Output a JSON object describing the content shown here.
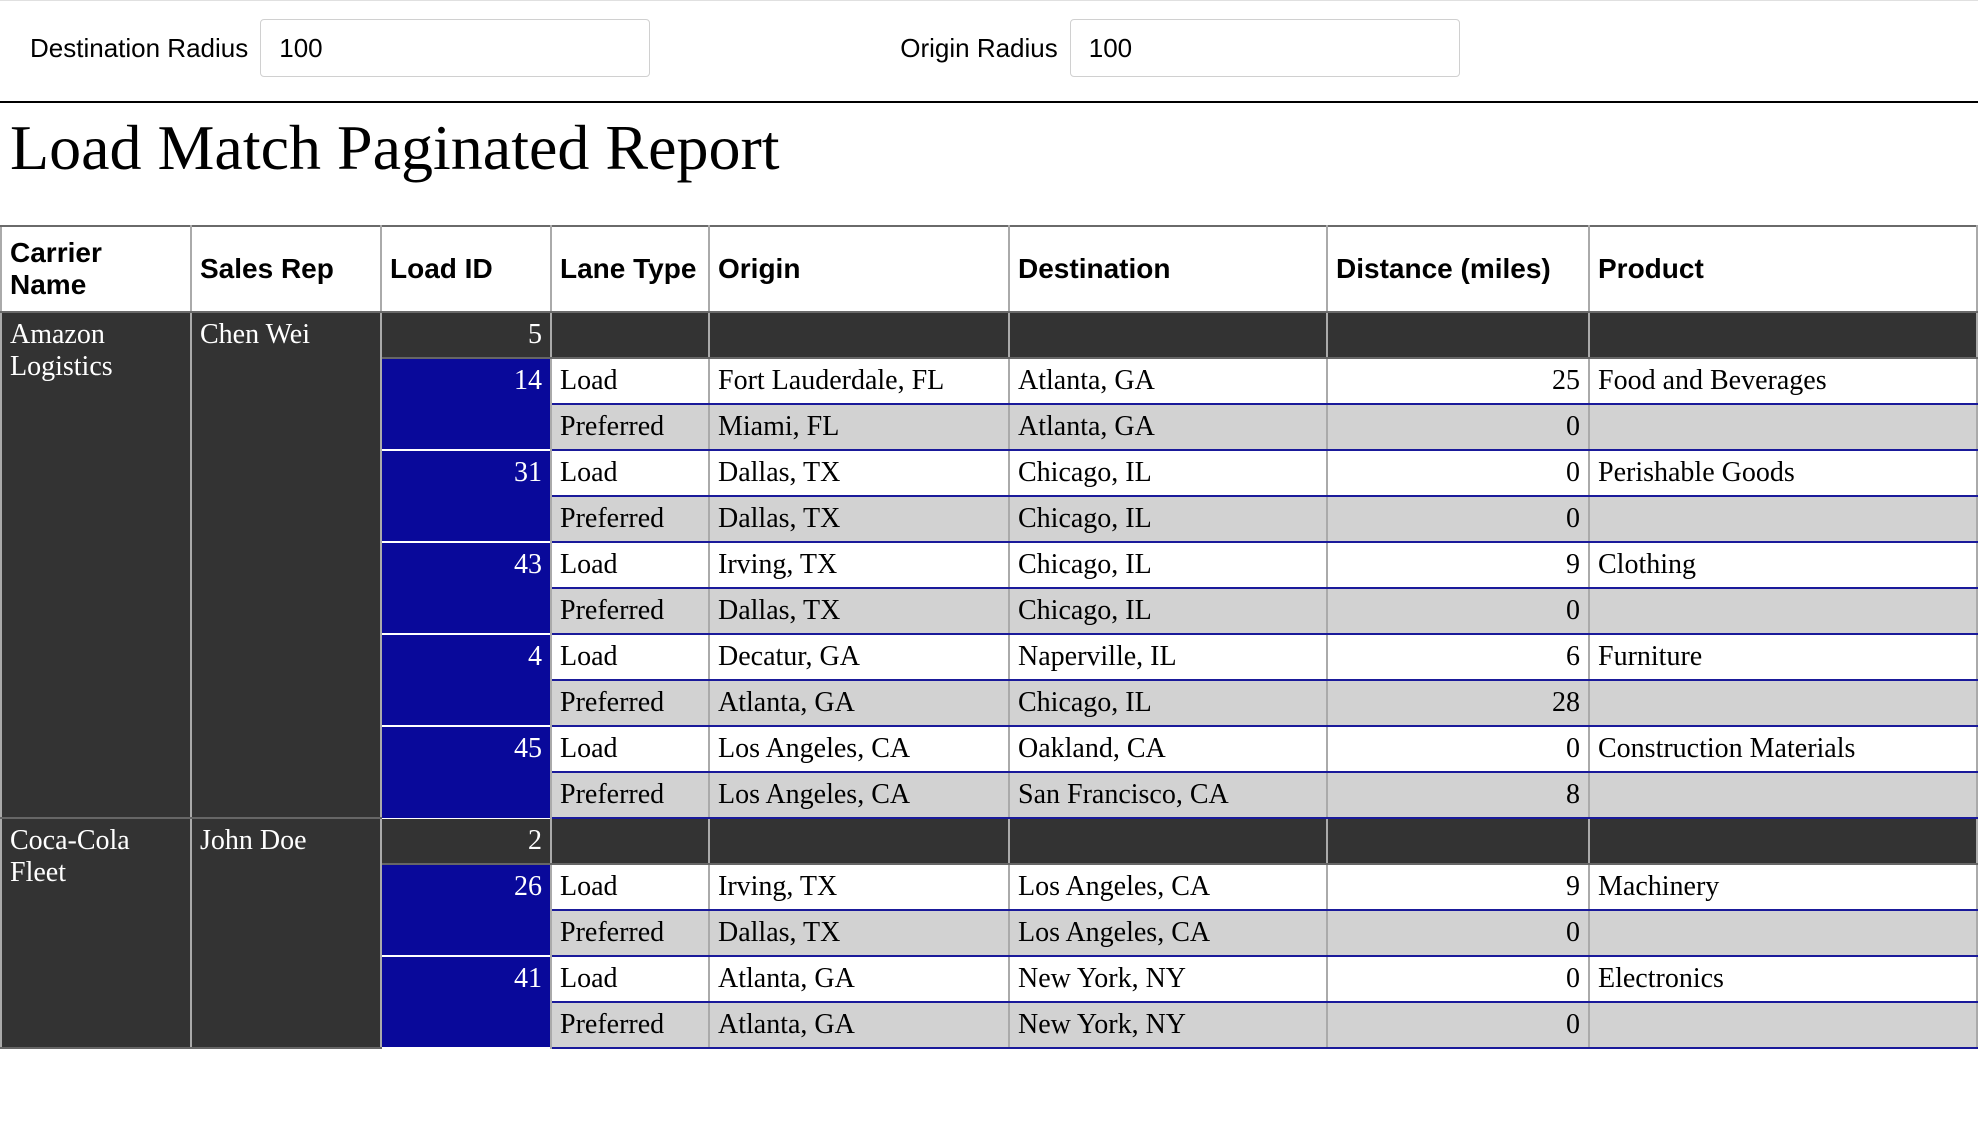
{
  "params": {
    "destination_radius_label": "Destination Radius",
    "destination_radius_value": "100",
    "origin_radius_label": "Origin Radius",
    "origin_radius_value": "100"
  },
  "title": "Load Match Paginated Report",
  "columns": {
    "carrier": "Carrier Name",
    "rep": "Sales Rep",
    "loadid": "Load ID",
    "lane": "Lane Type",
    "origin": "Origin",
    "dest": "Destination",
    "dist": "Distance (miles)",
    "prod": "Product"
  },
  "groups": [
    {
      "carrier": "Amazon Logistics",
      "rep": "Chen Wei",
      "count": "5",
      "loads": [
        {
          "loadid": "14",
          "load": {
            "lane": "Load",
            "origin": "Fort Lauderdale, FL",
            "dest": "Atlanta, GA",
            "dist": "25",
            "prod": "Food and Beverages"
          },
          "pref": {
            "lane": "Preferred",
            "origin": "Miami, FL",
            "dest": "Atlanta, GA",
            "dist": "0",
            "prod": ""
          }
        },
        {
          "loadid": "31",
          "load": {
            "lane": "Load",
            "origin": "Dallas, TX",
            "dest": "Chicago, IL",
            "dist": "0",
            "prod": "Perishable Goods"
          },
          "pref": {
            "lane": "Preferred",
            "origin": "Dallas, TX",
            "dest": "Chicago, IL",
            "dist": "0",
            "prod": ""
          }
        },
        {
          "loadid": "43",
          "load": {
            "lane": "Load",
            "origin": "Irving, TX",
            "dest": "Chicago, IL",
            "dist": "9",
            "prod": "Clothing"
          },
          "pref": {
            "lane": "Preferred",
            "origin": "Dallas, TX",
            "dest": "Chicago, IL",
            "dist": "0",
            "prod": ""
          }
        },
        {
          "loadid": "4",
          "load": {
            "lane": "Load",
            "origin": "Decatur, GA",
            "dest": "Naperville, IL",
            "dist": "6",
            "prod": "Furniture"
          },
          "pref": {
            "lane": "Preferred",
            "origin": "Atlanta, GA",
            "dest": "Chicago, IL",
            "dist": "28",
            "prod": ""
          }
        },
        {
          "loadid": "45",
          "load": {
            "lane": "Load",
            "origin": "Los Angeles, CA",
            "dest": "Oakland, CA",
            "dist": "0",
            "prod": "Construction Materials"
          },
          "pref": {
            "lane": "Preferred",
            "origin": "Los Angeles, CA",
            "dest": "San Francisco, CA",
            "dist": "8",
            "prod": ""
          }
        }
      ]
    },
    {
      "carrier": "Coca-Cola Fleet",
      "rep": "John Doe",
      "count": "2",
      "loads": [
        {
          "loadid": "26",
          "load": {
            "lane": "Load",
            "origin": "Irving, TX",
            "dest": "Los Angeles, CA",
            "dist": "9",
            "prod": "Machinery"
          },
          "pref": {
            "lane": "Preferred",
            "origin": "Dallas, TX",
            "dest": "Los Angeles, CA",
            "dist": "0",
            "prod": ""
          }
        },
        {
          "loadid": "41",
          "load": {
            "lane": "Load",
            "origin": "Atlanta, GA",
            "dest": "New York, NY",
            "dist": "0",
            "prod": "Electronics"
          },
          "pref": {
            "lane": "Preferred",
            "origin": "Atlanta, GA",
            "dest": "New York, NY",
            "dist": "0",
            "prod": ""
          }
        }
      ]
    }
  ]
}
